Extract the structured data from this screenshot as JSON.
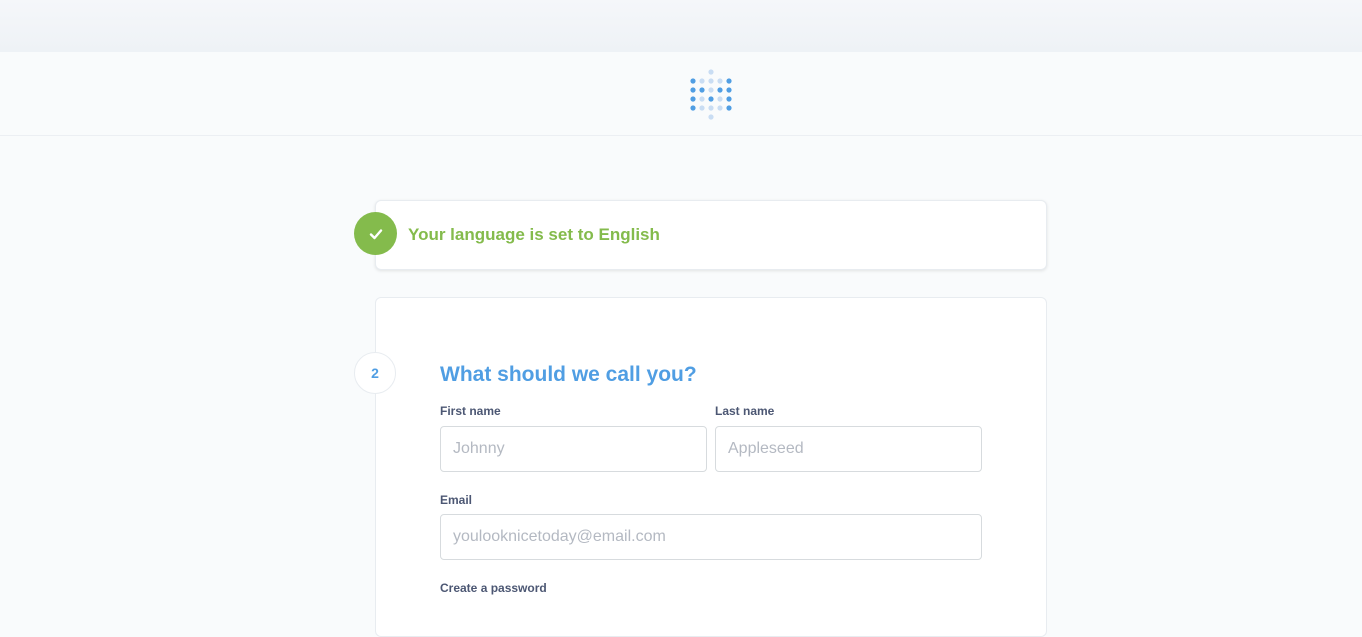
{
  "header": {
    "logo_icon": "metabase-logo-icon"
  },
  "language_step": {
    "icon": "check-icon",
    "text": "Your language is set to English",
    "color": "#84BB4C"
  },
  "user_step": {
    "number": "2",
    "title": "What should we call you?",
    "accent_color": "#509EE3",
    "first_name": {
      "label": "First name",
      "placeholder": "Johnny",
      "value": ""
    },
    "last_name": {
      "label": "Last name",
      "placeholder": "Appleseed",
      "value": ""
    },
    "email": {
      "label": "Email",
      "placeholder": "youlooknicetoday@email.com",
      "value": ""
    },
    "password": {
      "label": "Create a password"
    }
  }
}
